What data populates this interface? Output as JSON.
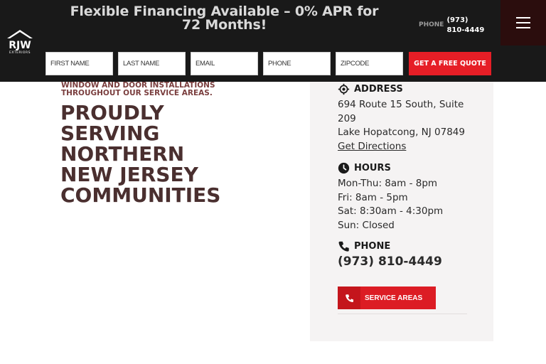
{
  "header": {
    "promo": "Flexible Financing Available – 0% APR for 72 Months!",
    "phone_label": "PHONE",
    "phone_number": "(973) 810-4449",
    "logo_text": "RJW",
    "logo_subtext": "EXTERIORS"
  },
  "form": {
    "first_name_placeholder": "First Name",
    "last_name_placeholder": "Last Name",
    "email_placeholder": "Email",
    "phone_placeholder": "Phone",
    "zipcode_placeholder": "Zipcode",
    "submit_label": "GET A FREE QUOTE"
  },
  "main": {
    "kicker": "WINDOW AND DOOR INSTALLATIONS THROUGHOUT OUR SERVICE AREAS.",
    "headline": "PROUDLY SERVING NORTHERN NEW JERSEY COMMUNITIES"
  },
  "card": {
    "address_heading": "ADDRESS",
    "address_line1": "694 Route 15 South, Suite 209",
    "address_line2": "Lake Hopatcong, NJ 07849",
    "directions_label": "Get Directions",
    "hours_heading": "HOURS",
    "hours": [
      "Mon-Thu: 8am - 8pm",
      "Fri: 8am - 5pm",
      "Sat: 8:30am - 4:30pm",
      "Sun: Closed"
    ],
    "phone_heading": "PHONE",
    "phone_number": "(973) 810-4449",
    "service_areas_label": "SERVICE AREAS"
  },
  "colors": {
    "header_bg": "#191919",
    "accent_red": "#e61e26",
    "headline": "#4a2f2f",
    "card_bg": "#f5f3f3"
  },
  "icons": {
    "menu": "hamburger-icon",
    "address": "location-target-icon",
    "hours": "clock-icon",
    "phone": "phone-icon"
  }
}
